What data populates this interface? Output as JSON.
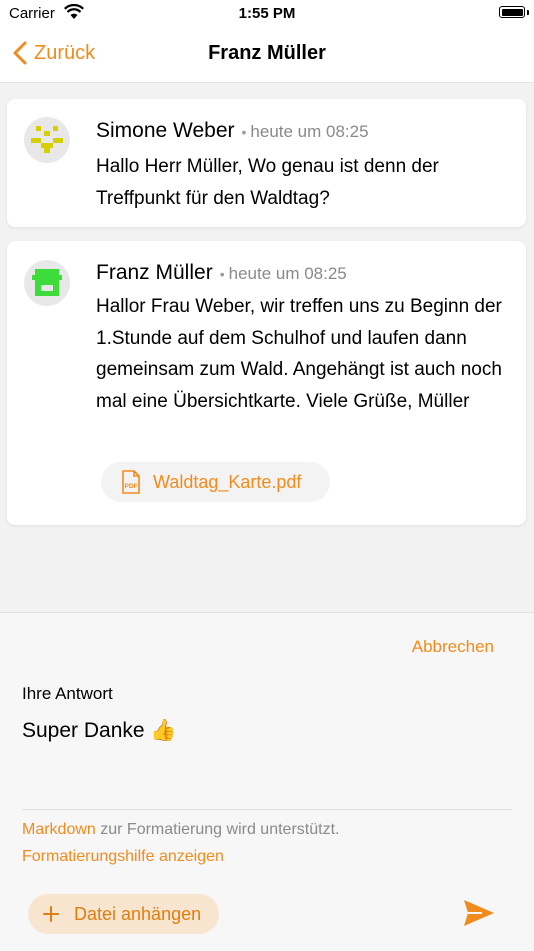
{
  "status_bar": {
    "carrier": "Carrier",
    "time": "1:55 PM"
  },
  "nav": {
    "back_label": "Zurück",
    "title": "Franz Müller"
  },
  "messages": [
    {
      "author": "Simone Weber",
      "timestamp": "heute um 08:25",
      "body": "Hallo Herr Müller, Wo genau ist denn der Treffpunkt für den Waldtag?",
      "avatar_color": "#d6d000"
    },
    {
      "author": "Franz Müller",
      "timestamp": "heute um 08:25",
      "body": "Hallor Frau Weber, wir treffen uns zu Beginn der 1.Stunde auf dem Schulhof und laufen dann gemeinsam zum Wald. Angehängt ist auch noch mal eine Übersichtkarte. Viele Grüße, Müller",
      "avatar_color": "#3ddc3a",
      "attachment": {
        "filename": "Waldtag_Karte.pdf",
        "icon": "pdf-file-icon"
      }
    }
  ],
  "reply": {
    "cancel_label": "Abbrechen",
    "label": "Ihre Antwort",
    "value": "Super Danke 👍",
    "hint_link": "Markdown",
    "hint_text": " zur Formatierung wird unterstützt.",
    "help_link": "Formatierungshilfe anzeigen",
    "attach_label": "Datei anhängen",
    "send_icon": "send-icon"
  },
  "colors": {
    "accent": "#f08c1e",
    "attach_bg": "#f7e5cf"
  }
}
